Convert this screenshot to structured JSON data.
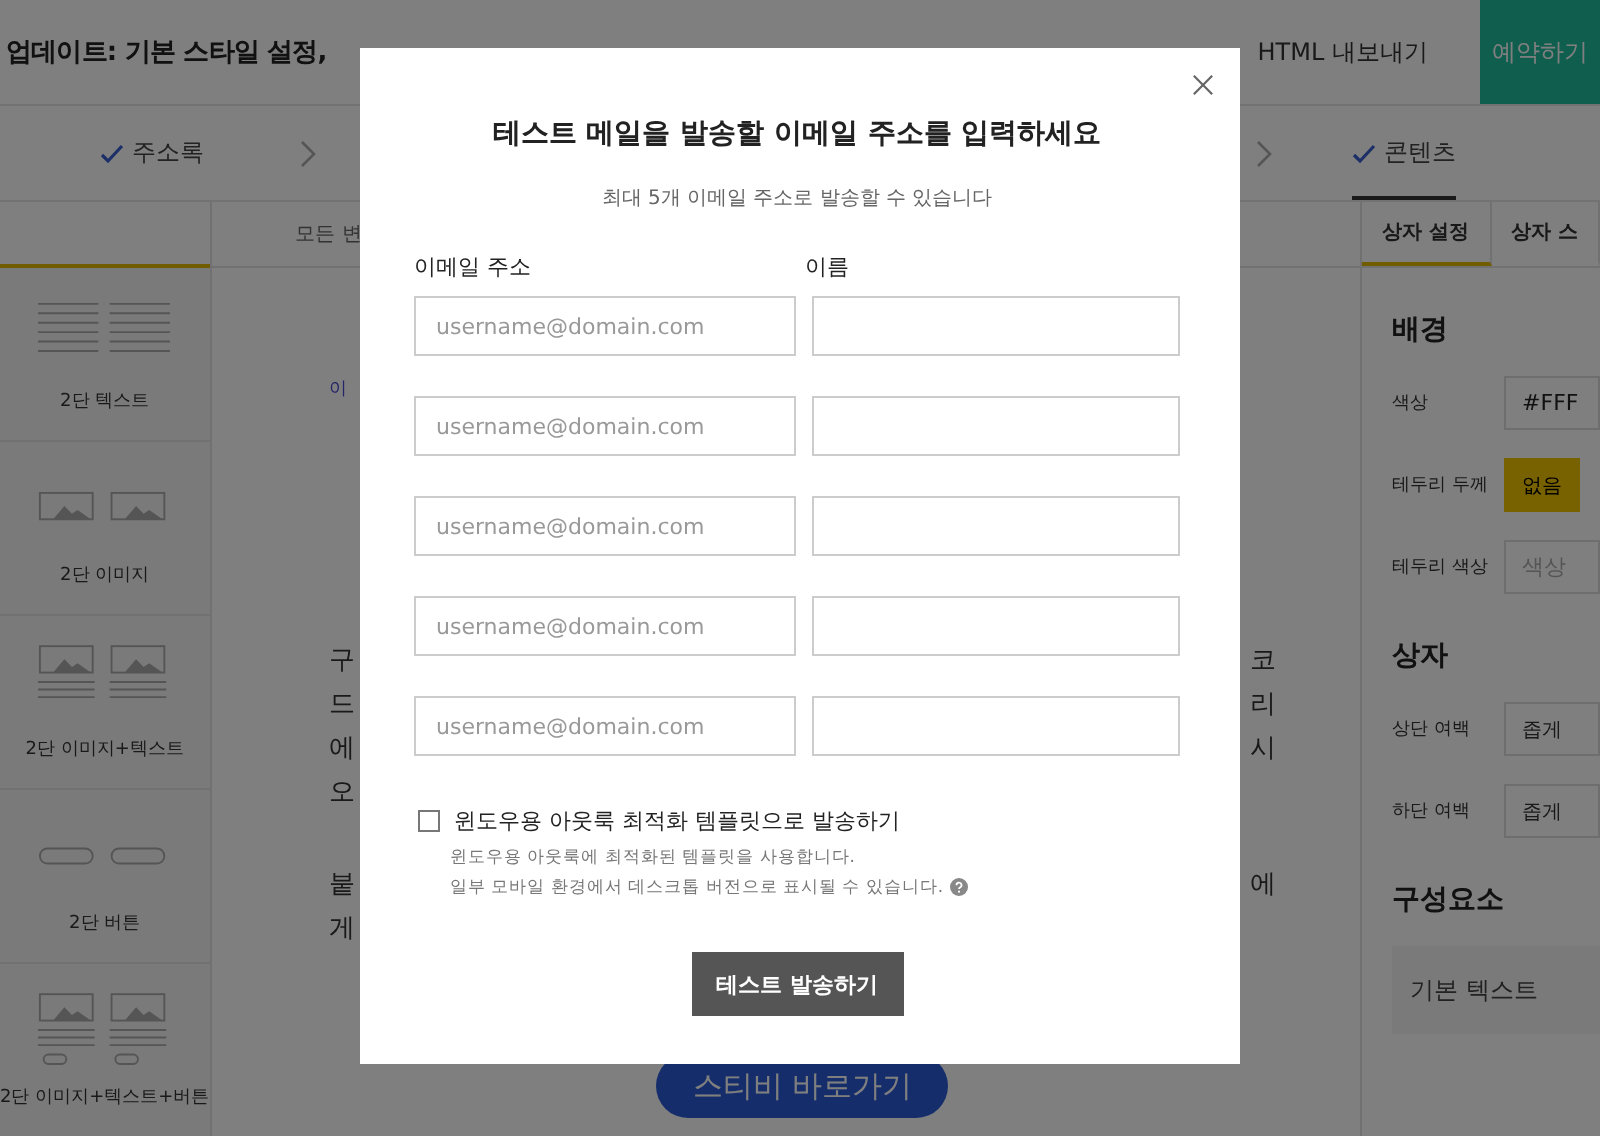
{
  "header": {
    "title": "업데이트: 기본 스타일 설정,",
    "actions": [
      {
        "label": "HTML 내보내기",
        "kind": "link"
      },
      {
        "label": "예약하기",
        "kind": "primary"
      }
    ]
  },
  "steps": [
    {
      "label": "주소록",
      "checked": true,
      "selected": false
    },
    {
      "label": "콘텐츠",
      "checked": true,
      "selected": true
    }
  ],
  "blocks": [
    {
      "label": "2단 텍스트",
      "kind": "text"
    },
    {
      "label": "2단 이미지",
      "kind": "image"
    },
    {
      "label": "2단 이미지+텍스트",
      "kind": "image_text"
    },
    {
      "label": "2단 버튼",
      "kind": "button"
    },
    {
      "label": "2단 이미지+텍스트+버튼",
      "kind": "image_text_button"
    }
  ],
  "canvas": {
    "toolbar_text": "모든 변",
    "link": "이",
    "paragraphs": [
      {
        "lines": [
          {
            "left": "구",
            "right": "코"
          },
          {
            "left": "드",
            "right": "리"
          },
          {
            "left": "에",
            "right": "시"
          },
          {
            "left": "오"
          }
        ]
      },
      {
        "lines": [
          {
            "left": "붙",
            "right": "에"
          },
          {
            "left": "게"
          }
        ]
      }
    ],
    "button": "스티비 바로가기"
  },
  "panel": {
    "tabs": [
      {
        "label": "상자 설정",
        "selected": true
      },
      {
        "label": "상자 스",
        "selected": false
      }
    ],
    "sections": [
      {
        "title": "배경",
        "rows": [
          {
            "label": "색상",
            "value": "#FFF",
            "kind": "field"
          },
          {
            "label": "테두리 두께",
            "value": "없음",
            "kind": "toggle",
            "selected": true
          },
          {
            "label": "테두리 색상",
            "placeholder": "색상",
            "kind": "field"
          }
        ]
      },
      {
        "title": "상자",
        "rows": [
          {
            "label": "상단 여백",
            "value": "좁게",
            "kind": "select"
          },
          {
            "label": "하단 여백",
            "value": "좁게",
            "kind": "select"
          }
        ]
      },
      {
        "title": "구성요소",
        "items": [
          "기본 텍스트"
        ]
      }
    ]
  },
  "modal": {
    "title": "테스트 메일을 발송할 이메일 주소를 입력하세요",
    "subtitle": "최대 5개 이메일 주소로 발송할 수 있습니다",
    "email_label": "이메일 주소",
    "name_label": "이름",
    "recipients": [
      {
        "placeholder": "username@domain.com"
      },
      {
        "placeholder": "username@domain.com"
      },
      {
        "placeholder": "username@domain.com"
      },
      {
        "placeholder": "username@domain.com"
      },
      {
        "placeholder": "username@domain.com"
      }
    ],
    "option": {
      "label": "윈도우용 아웃룩 최적화 템플릿으로 발송하기",
      "checked": false,
      "hints": [
        "윈도우용 아웃룩에 최적화된 템플릿을 사용합니다.",
        "일부 모바일 환경에서 데스크톱 버전으로 표시될 수 있습니다."
      ]
    },
    "button": "테스트 발송하기"
  }
}
